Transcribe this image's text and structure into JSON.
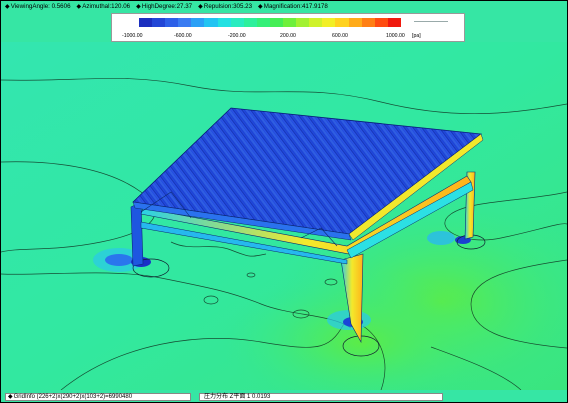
{
  "header": {
    "items": [
      "ViewingAngle: 0.5606",
      "Azimuthal:120.06",
      "HighDegree:27.37",
      "Repulsion:305.23",
      "Magnification:417.9178"
    ]
  },
  "legend": {
    "ticks": [
      "-1000.00",
      "-600.00",
      "-200.00",
      "200.00",
      "600.00",
      "1000.00"
    ],
    "unit": "[pa]",
    "colors": [
      "#1b2fbf",
      "#2246d6",
      "#2d60e8",
      "#3a7cf2",
      "#2aa0f6",
      "#22c4f2",
      "#23e1e2",
      "#28ecc0",
      "#2df09c",
      "#34f079",
      "#45ee55",
      "#6ef03c",
      "#a2f132",
      "#cff22a",
      "#f2ef26",
      "#ffd21f",
      "#ffab19",
      "#ff7f14",
      "#ff4c10",
      "#f01a0e"
    ]
  },
  "status": {
    "left": "GridInfo  (226+2)x(290+2)x(103+2)=6990480",
    "right": "圧力分布  Z平面  1  0.0193"
  }
}
